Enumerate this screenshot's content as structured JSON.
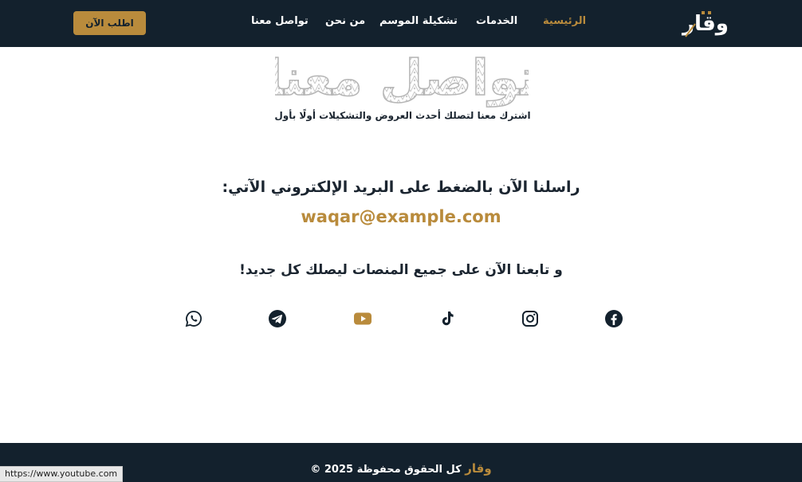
{
  "header": {
    "logo_text": "وقار",
    "cta_label": "اطلب الآن",
    "nav": [
      {
        "label": "الرئيسية",
        "active": true
      },
      {
        "label": "الخدمات",
        "active": false
      },
      {
        "label": "تشكيلة الموسم",
        "active": false
      },
      {
        "label": "من نحن",
        "active": false
      },
      {
        "label": "تواصل معنا",
        "active": false
      }
    ]
  },
  "hero": {
    "title": "تواصل معنا",
    "subtitle": "اشترك معنا لتصلك أحدث العروض والتشكيلات أولًا بأول"
  },
  "contact": {
    "mail_heading": "راسلنا الآن بالضغط على البريد الإلكتروني الآتي:",
    "email": "waqar@example.com",
    "follow_heading": "و تابعنا الآن على جميع المنصات ليصلك كل جديد!"
  },
  "social_icons": [
    "facebook-icon",
    "instagram-icon",
    "tiktok-icon",
    "youtube-icon",
    "telegram-icon",
    "whatsapp-icon"
  ],
  "footer": {
    "brand": "وقار",
    "copyright": "كل الحقوق محفوظة 2025 ©"
  },
  "status_url": "https://www.youtube.com",
  "colors": {
    "navy": "#13212d",
    "gold": "#b98b3c",
    "text": "#1b2530"
  }
}
